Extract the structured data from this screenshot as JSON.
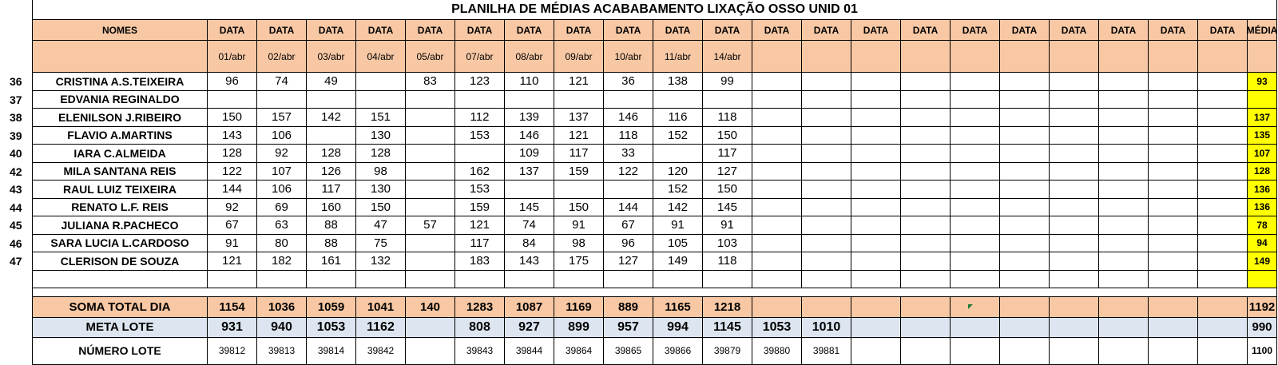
{
  "sheet": {
    "title": "PLANILHA DE MÉDIAS ACABABAMENTO LIXAÇÃO OSSO UNID 01",
    "header": {
      "names_label": "NOMES",
      "date_label": "DATA",
      "average_label": "MÉDIA",
      "dates": [
        "01/abr",
        "02/abr",
        "03/abr",
        "04/abr",
        "05/abr",
        "07/abr",
        "08/abr",
        "09/abr",
        "10/abr",
        "11/abr",
        "14/abr",
        "",
        "",
        "",
        "",
        "",
        "",
        "",
        "",
        "",
        ""
      ]
    },
    "rows": [
      {
        "num": "36",
        "name": "CRISTINA A.S.TEIXEIRA",
        "values": [
          "96",
          "74",
          "49",
          "",
          "83",
          "123",
          "110",
          "121",
          "36",
          "138",
          "99"
        ],
        "avg": "93"
      },
      {
        "num": "37",
        "name": "EDVANIA REGINALDO",
        "values": [
          "",
          "",
          "",
          "",
          "",
          "",
          "",
          "",
          "",
          "",
          ""
        ],
        "avg": ""
      },
      {
        "num": "38",
        "name": "ELENILSON J.RIBEIRO",
        "values": [
          "150",
          "157",
          "142",
          "151",
          "",
          "112",
          "139",
          "137",
          "146",
          "116",
          "118"
        ],
        "avg": "137"
      },
      {
        "num": "39",
        "name": "FLAVIO A.MARTINS",
        "values": [
          "143",
          "106",
          "",
          "130",
          "",
          "153",
          "146",
          "121",
          "118",
          "152",
          "150"
        ],
        "avg": "135"
      },
      {
        "num": "40",
        "name": "IARA C.ALMEIDA",
        "values": [
          "128",
          "92",
          "128",
          "128",
          "",
          "",
          "109",
          "117",
          "33",
          "",
          "117"
        ],
        "avg": "107"
      },
      {
        "num": "42",
        "name": "MILA SANTANA REIS",
        "values": [
          "122",
          "107",
          "126",
          "98",
          "",
          "162",
          "137",
          "159",
          "122",
          "120",
          "127"
        ],
        "avg": "128"
      },
      {
        "num": "43",
        "name": "RAUL LUIZ TEIXEIRA",
        "values": [
          "144",
          "106",
          "117",
          "130",
          "",
          "153",
          "",
          "",
          "",
          "152",
          "150"
        ],
        "avg": "136"
      },
      {
        "num": "44",
        "name": "RENATO L.F. REIS",
        "values": [
          "92",
          "69",
          "160",
          "150",
          "",
          "159",
          "145",
          "150",
          "144",
          "142",
          "145"
        ],
        "avg": "136"
      },
      {
        "num": "45",
        "name": "JULIANA R.PACHECO",
        "values": [
          "67",
          "63",
          "88",
          "47",
          "57",
          "121",
          "74",
          "91",
          "67",
          "91",
          "91"
        ],
        "avg": "78"
      },
      {
        "num": "46",
        "name": "SARA LUCIA L.CARDOSO",
        "values": [
          "91",
          "80",
          "88",
          "75",
          "",
          "117",
          "84",
          "98",
          "96",
          "105",
          "103"
        ],
        "avg": "94"
      },
      {
        "num": "47",
        "name": "CLERISON DE SOUZA",
        "values": [
          "121",
          "182",
          "161",
          "132",
          "",
          "183",
          "143",
          "175",
          "127",
          "149",
          "118"
        ],
        "avg": "149"
      }
    ],
    "totals": {
      "sum": {
        "label": "SOMA TOTAL DIA",
        "values": [
          "1154",
          "1036",
          "1059",
          "1041",
          "140",
          "1283",
          "1087",
          "1169",
          "889",
          "1165",
          "1218"
        ],
        "avg": "1192"
      },
      "meta": {
        "label": "META LOTE",
        "values": [
          "931",
          "940",
          "1053",
          "1162",
          "",
          "808",
          "927",
          "899",
          "957",
          "994",
          "1145",
          "1053",
          "1010"
        ],
        "avg": "990"
      },
      "lote": {
        "label": "NÚMERO LOTE",
        "values": [
          "39812",
          "39813",
          "39814",
          "39842",
          "",
          "39843",
          "39844",
          "39864",
          "39865",
          "39866",
          "39879",
          "39880",
          "39881"
        ],
        "avg": "1100"
      }
    },
    "colors": {
      "header_fill": "#f8c8a4",
      "average_fill": "#ffff00",
      "meta_fill": "#dde6f0",
      "grid": "#000000"
    }
  }
}
